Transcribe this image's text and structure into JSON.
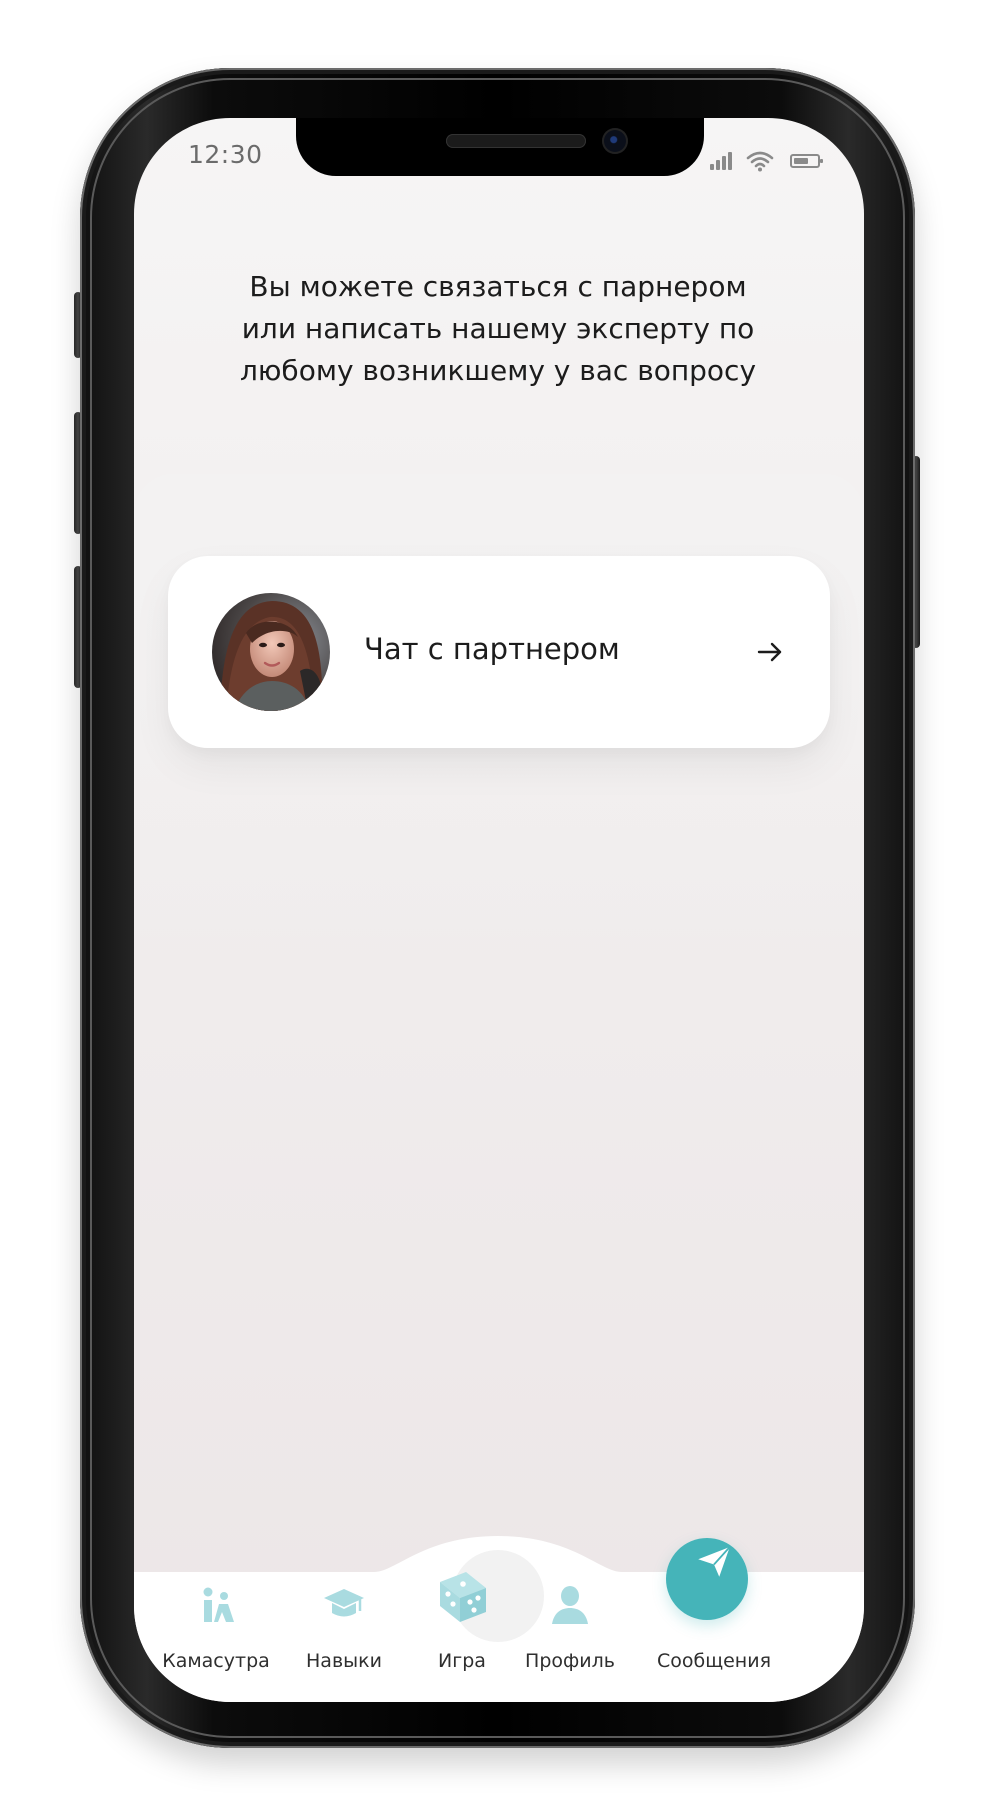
{
  "status_bar": {
    "time": "12:30"
  },
  "intro": {
    "line1": "Вы можете связаться с парнером",
    "line2": "или написать нашему эксперту по",
    "line3": "любому возникшему у вас вопросу"
  },
  "chat_card": {
    "label": "Чат с партнером",
    "arrow_icon": "arrow-right-icon"
  },
  "nav": {
    "tabs": [
      {
        "label": "Камасутра",
        "icon": "couple-icon"
      },
      {
        "label": "Навыки",
        "icon": "graduation-cap-icon"
      },
      {
        "label": "Игра",
        "icon": "dice-icon"
      },
      {
        "label": "Профиль",
        "icon": "person-icon"
      },
      {
        "label": "Сообщения",
        "icon": "paper-plane-icon",
        "active": true
      }
    ]
  },
  "colors": {
    "accent": "#45b4b9",
    "accent_light": "#a9dbe0",
    "text_primary": "#1c1c1c",
    "text_muted": "#6b6b6b",
    "card_bg": "#ffffff",
    "screen_bg": "#f1eeee"
  }
}
